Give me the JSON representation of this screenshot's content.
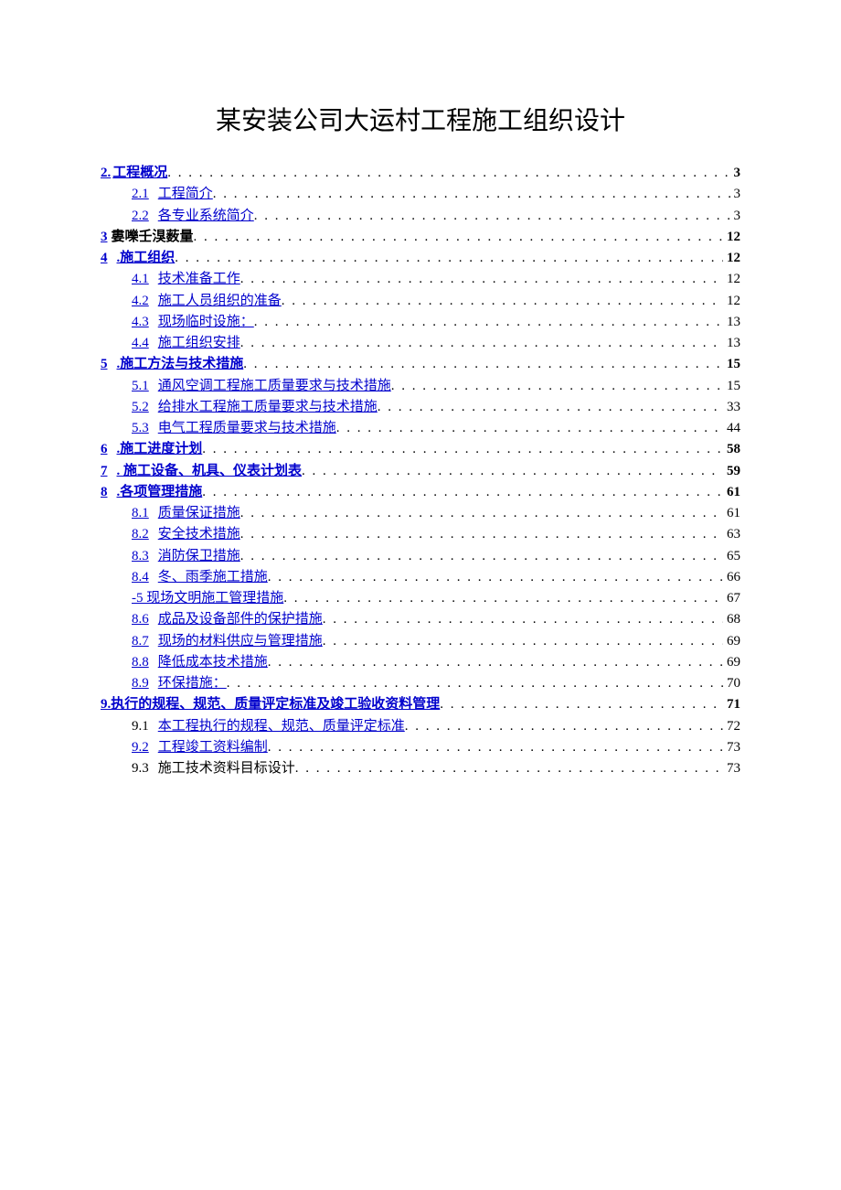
{
  "title": "某安装公司大运村工程施工组织设计",
  "toc": [
    {
      "indent": 0,
      "bold": true,
      "link": true,
      "num_link": true,
      "txt_link": true,
      "num": "2.",
      "gap": 2,
      "txt": "工程概况",
      "page": "3"
    },
    {
      "indent": 34,
      "bold": false,
      "link": true,
      "num_link": true,
      "txt_link": true,
      "num": "2.1",
      "gap": 10,
      "txt": "工程简介",
      "page": "3"
    },
    {
      "indent": 34,
      "bold": false,
      "link": true,
      "num_link": true,
      "txt_link": true,
      "num": "2.2",
      "gap": 10,
      "txt": "各专业系统简介",
      "page": "3"
    },
    {
      "indent": 0,
      "bold": true,
      "link": true,
      "num_link": true,
      "txt_link": false,
      "num": "3",
      "gap": 4,
      "txt": "婁嚛壬湨薮量",
      "page": "12"
    },
    {
      "indent": 0,
      "bold": true,
      "link": true,
      "num_link": true,
      "txt_link": true,
      "num": "4",
      "gap": 10,
      "txt": ".施工组织",
      "page": "12"
    },
    {
      "indent": 34,
      "bold": false,
      "link": true,
      "num_link": true,
      "txt_link": true,
      "num": "4.1",
      "gap": 10,
      "txt": "技术准备工作",
      "page": "12"
    },
    {
      "indent": 34,
      "bold": false,
      "link": true,
      "num_link": true,
      "txt_link": true,
      "num": "4.2",
      "gap": 10,
      "txt": "施工人员组织的准备",
      "page": "12"
    },
    {
      "indent": 34,
      "bold": false,
      "link": true,
      "num_link": true,
      "txt_link": true,
      "num": "4.3",
      "gap": 10,
      "txt": "现场临时设施：",
      "page": "13"
    },
    {
      "indent": 34,
      "bold": false,
      "link": true,
      "num_link": true,
      "txt_link": true,
      "num": "4.4",
      "gap": 10,
      "txt": "施工组织安排",
      "page": "13"
    },
    {
      "indent": 0,
      "bold": true,
      "link": true,
      "num_link": true,
      "txt_link": true,
      "num": "5",
      "gap": 10,
      "txt": ".施工方法与技术措施",
      "page": "15"
    },
    {
      "indent": 34,
      "bold": false,
      "link": true,
      "num_link": true,
      "txt_link": true,
      "num": "5.1",
      "gap": 10,
      "txt": "通风空调工程施工质量要求与技术措施",
      "page": "15"
    },
    {
      "indent": 34,
      "bold": false,
      "link": true,
      "num_link": true,
      "txt_link": true,
      "num": "5.2",
      "gap": 10,
      "txt": "给排水工程施工质量要求与技术措施",
      "page": "33"
    },
    {
      "indent": 34,
      "bold": false,
      "link": true,
      "num_link": true,
      "txt_link": true,
      "num": "5.3",
      "gap": 10,
      "txt": "电气工程质量要求与技术措施",
      "page": "44"
    },
    {
      "indent": 0,
      "bold": true,
      "link": true,
      "num_link": true,
      "txt_link": true,
      "num": "6",
      "gap": 10,
      "txt": ".施工进度计划",
      "page": "58"
    },
    {
      "indent": 0,
      "bold": true,
      "link": true,
      "num_link": true,
      "txt_link": true,
      "num": "7",
      "gap": 10,
      "txt": ". 施工设备、机具、仪表计划表",
      "page": "59"
    },
    {
      "indent": 0,
      "bold": true,
      "link": true,
      "num_link": true,
      "txt_link": true,
      "num": "8",
      "gap": 10,
      "txt": ".各项管理措施",
      "page": "61"
    },
    {
      "indent": 34,
      "bold": false,
      "link": true,
      "num_link": true,
      "txt_link": true,
      "num": "8.1",
      "gap": 10,
      "txt": "质量保证措施",
      "page": "61"
    },
    {
      "indent": 34,
      "bold": false,
      "link": true,
      "num_link": true,
      "txt_link": true,
      "num": "8.2",
      "gap": 10,
      "txt": "安全技术措施",
      "page": "63"
    },
    {
      "indent": 34,
      "bold": false,
      "link": true,
      "num_link": true,
      "txt_link": true,
      "num": "8.3",
      "gap": 10,
      "txt": "消防保卫措施",
      "page": "65"
    },
    {
      "indent": 34,
      "bold": false,
      "link": true,
      "num_link": true,
      "txt_link": true,
      "num": "8.4",
      "gap": 10,
      "txt": "冬、雨季施工措施",
      "page": "66"
    },
    {
      "indent": 34,
      "bold": false,
      "link": true,
      "whole": true,
      "num": "",
      "gap": 0,
      "txt": "-5 现场文明施工管理措施",
      "page": "67"
    },
    {
      "indent": 34,
      "bold": false,
      "link": true,
      "num_link": true,
      "txt_link": true,
      "num": "8.6",
      "gap": 10,
      "txt": "成品及设备部件的保护措施",
      "page": "68"
    },
    {
      "indent": 34,
      "bold": false,
      "link": true,
      "num_link": true,
      "txt_link": true,
      "num": "8.7",
      "gap": 10,
      "txt": "现场的材料供应与管理措施",
      "page": "69"
    },
    {
      "indent": 34,
      "bold": false,
      "link": true,
      "num_link": true,
      "txt_link": true,
      "num": "8.8",
      "gap": 10,
      "txt": "降低成本技术措施",
      "page": "69"
    },
    {
      "indent": 34,
      "bold": false,
      "link": true,
      "num_link": true,
      "txt_link": true,
      "num": "8.9",
      "gap": 10,
      "txt": "环保措施：",
      "page": "70"
    },
    {
      "indent": 0,
      "bold": true,
      "link": true,
      "whole": true,
      "num": "",
      "gap": 0,
      "txt": "9.执行的规程、规范、质量评定标准及竣工验收资料管理",
      "page": "71"
    },
    {
      "indent": 34,
      "bold": false,
      "link": true,
      "num_link": false,
      "txt_link": true,
      "num": "9.1",
      "gap": 10,
      "txt": "本工程执行的规程、规范、质量评定标准",
      "page": "72"
    },
    {
      "indent": 34,
      "bold": false,
      "link": true,
      "num_link": true,
      "txt_link": true,
      "num": "9.2",
      "gap": 10,
      "txt": "工程竣工资料编制",
      "page": "73"
    },
    {
      "indent": 34,
      "bold": false,
      "link": false,
      "num_link": false,
      "txt_link": false,
      "num": "9.3",
      "gap": 10,
      "txt": "施工技术资料目标设计",
      "page": "73"
    }
  ]
}
